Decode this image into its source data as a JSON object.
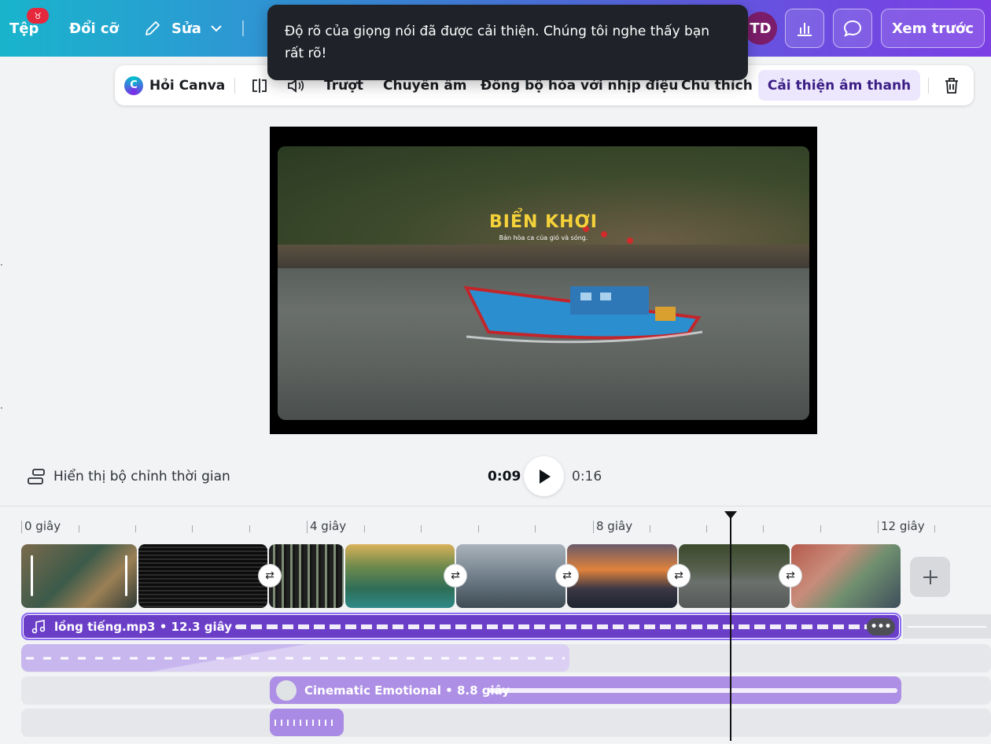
{
  "topbar": {
    "file": "Tệp",
    "file_badge": "♉",
    "resize": "Đổi cỡ",
    "edit": "Sửa",
    "avatar": "TD",
    "preview": "Xem trước"
  },
  "toast": {
    "message": "Độ rõ của giọng nói đã được cải thiện. Chúng tôi nghe thấy bạn rất rõ!"
  },
  "context_toolbar": {
    "ask_canva": "Hỏi Canva",
    "slide": "Trượt",
    "transcribe": "Chuyển âm",
    "beat_sync": "Đồng bộ hóa với nhịp điệu",
    "caption": "Chú thích",
    "enhance_audio": "Cải thiện âm thanh"
  },
  "canvas": {
    "slide_title": "BIỂN KHƠI",
    "slide_subtitle": "Bản hòa ca của gió và sóng."
  },
  "player": {
    "timeline_toggle": "Hiển thị bộ chỉnh thời gian",
    "current_time": "0:09",
    "total_time": "0:16"
  },
  "timeline": {
    "ruler": [
      "0 giây",
      "4 giây",
      "8 giây",
      "12 giây"
    ],
    "audio_tracks": [
      {
        "label": "lồng tiếng.mp3 • 12.3 giây"
      },
      {
        "label": ""
      },
      {
        "label": "Cinematic Emotional • 8.8 giây"
      },
      {
        "label": ""
      }
    ]
  },
  "colors": {
    "selected_audio": "#6b3ec8",
    "accent_purple": "#7d2ae8",
    "toast_bg": "#1f2329"
  }
}
